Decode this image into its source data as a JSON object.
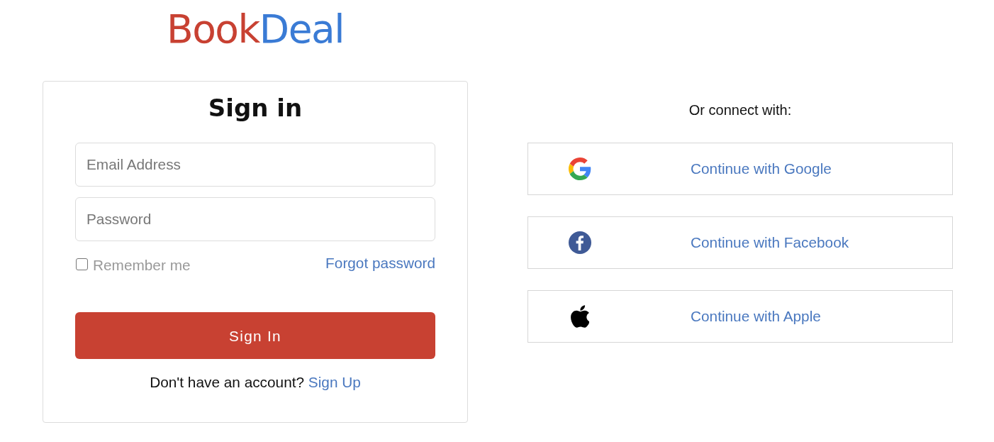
{
  "logo": {
    "parts": [
      "Book",
      "Deal"
    ]
  },
  "sign_in": {
    "title": "Sign in",
    "email": {
      "placeholder": "Email Address"
    },
    "password": {
      "placeholder": "Password"
    },
    "remember_me": {
      "label": "Remember me",
      "checked": false
    },
    "forgot_password": "Forgot password",
    "submit": "Sign In",
    "signup_prompt": "Don't have an account?",
    "signup_link": "Sign Up"
  },
  "social": {
    "heading": "Or connect with:",
    "providers": [
      {
        "kind": "google",
        "label": "Continue with Google"
      },
      {
        "kind": "facebook",
        "label": "Continue with Facebook"
      },
      {
        "kind": "apple",
        "label": "Continue with Apple"
      }
    ]
  }
}
